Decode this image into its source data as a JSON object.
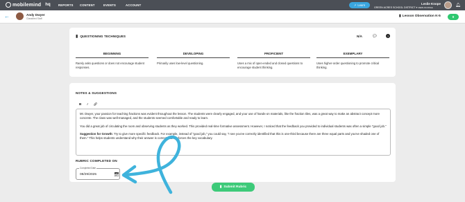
{
  "topnav": {
    "logo_text": "mobilemind",
    "logo_suffix": "hq",
    "items": [
      "REPORTS",
      "CONTENT",
      "EVENTS",
      "ACCOUNT"
    ],
    "learn_label": "Learn",
    "user_name": "Leslie Knope",
    "district": "GREEN ACRES SCHOOL DISTRICT",
    "district_sub": "VIEW AS ROLE"
  },
  "subbar": {
    "person_name": "Andy Dwyer",
    "person_role": "Classified Staff",
    "observation_title": "Lesson Observation K-5",
    "count": "0"
  },
  "rubric": {
    "section_title": "QUESTIONING TECHNIQUES",
    "score": "N/A",
    "levels": [
      {
        "label": "BEGINNING",
        "desc": "Rarely asks questions or does not encourage student responses."
      },
      {
        "label": "DEVELOPING",
        "desc": "Primarily uses low-level questioning."
      },
      {
        "label": "PROFICIENT",
        "desc": "Uses a mix of open-ended and closed questions to encourage student thinking."
      },
      {
        "label": "EXEMPLARY",
        "desc": "Uses higher-order questioning to promote critical thinking."
      }
    ]
  },
  "notes": {
    "title": "NOTES & SUGGESTIONS",
    "p1": "Mr. Dwyer, your passion for teaching fractions was evident throughout the lesson. The students were clearly engaged, and your use of hands-on materials, like the fraction tiles, was a great way to make an abstract concept more concrete. The class was well-managed, and the students seemed comfortable and ready to learn.",
    "p2": "You did a great job of circulating the room and observing students as they worked. This provided real-time formative assessment. However, I noticed that the feedback you provided to individual students was often a simple \"good job.\"",
    "p3_bold": "Suggestion for Growth:",
    "p3": " Try to give more specific feedback. For example, instead of \"good job,\" you could say, \"I see you've correctly identified that this is one-third because there are three equal parts and you've shaded one of them.\" This helps students understand why their answer is correct and reinforces the key vocabulary."
  },
  "completed": {
    "title": "RUBRIC COMPLETED ON",
    "field_label": "Completed Date",
    "value": "08/29/2025"
  },
  "submit_label": "Submit Rubric",
  "colors": {
    "nav_bg": "#4b4f56",
    "accent_blue": "#3aa6df",
    "green": "#3dca79",
    "annotation": "#3fb3dc"
  }
}
